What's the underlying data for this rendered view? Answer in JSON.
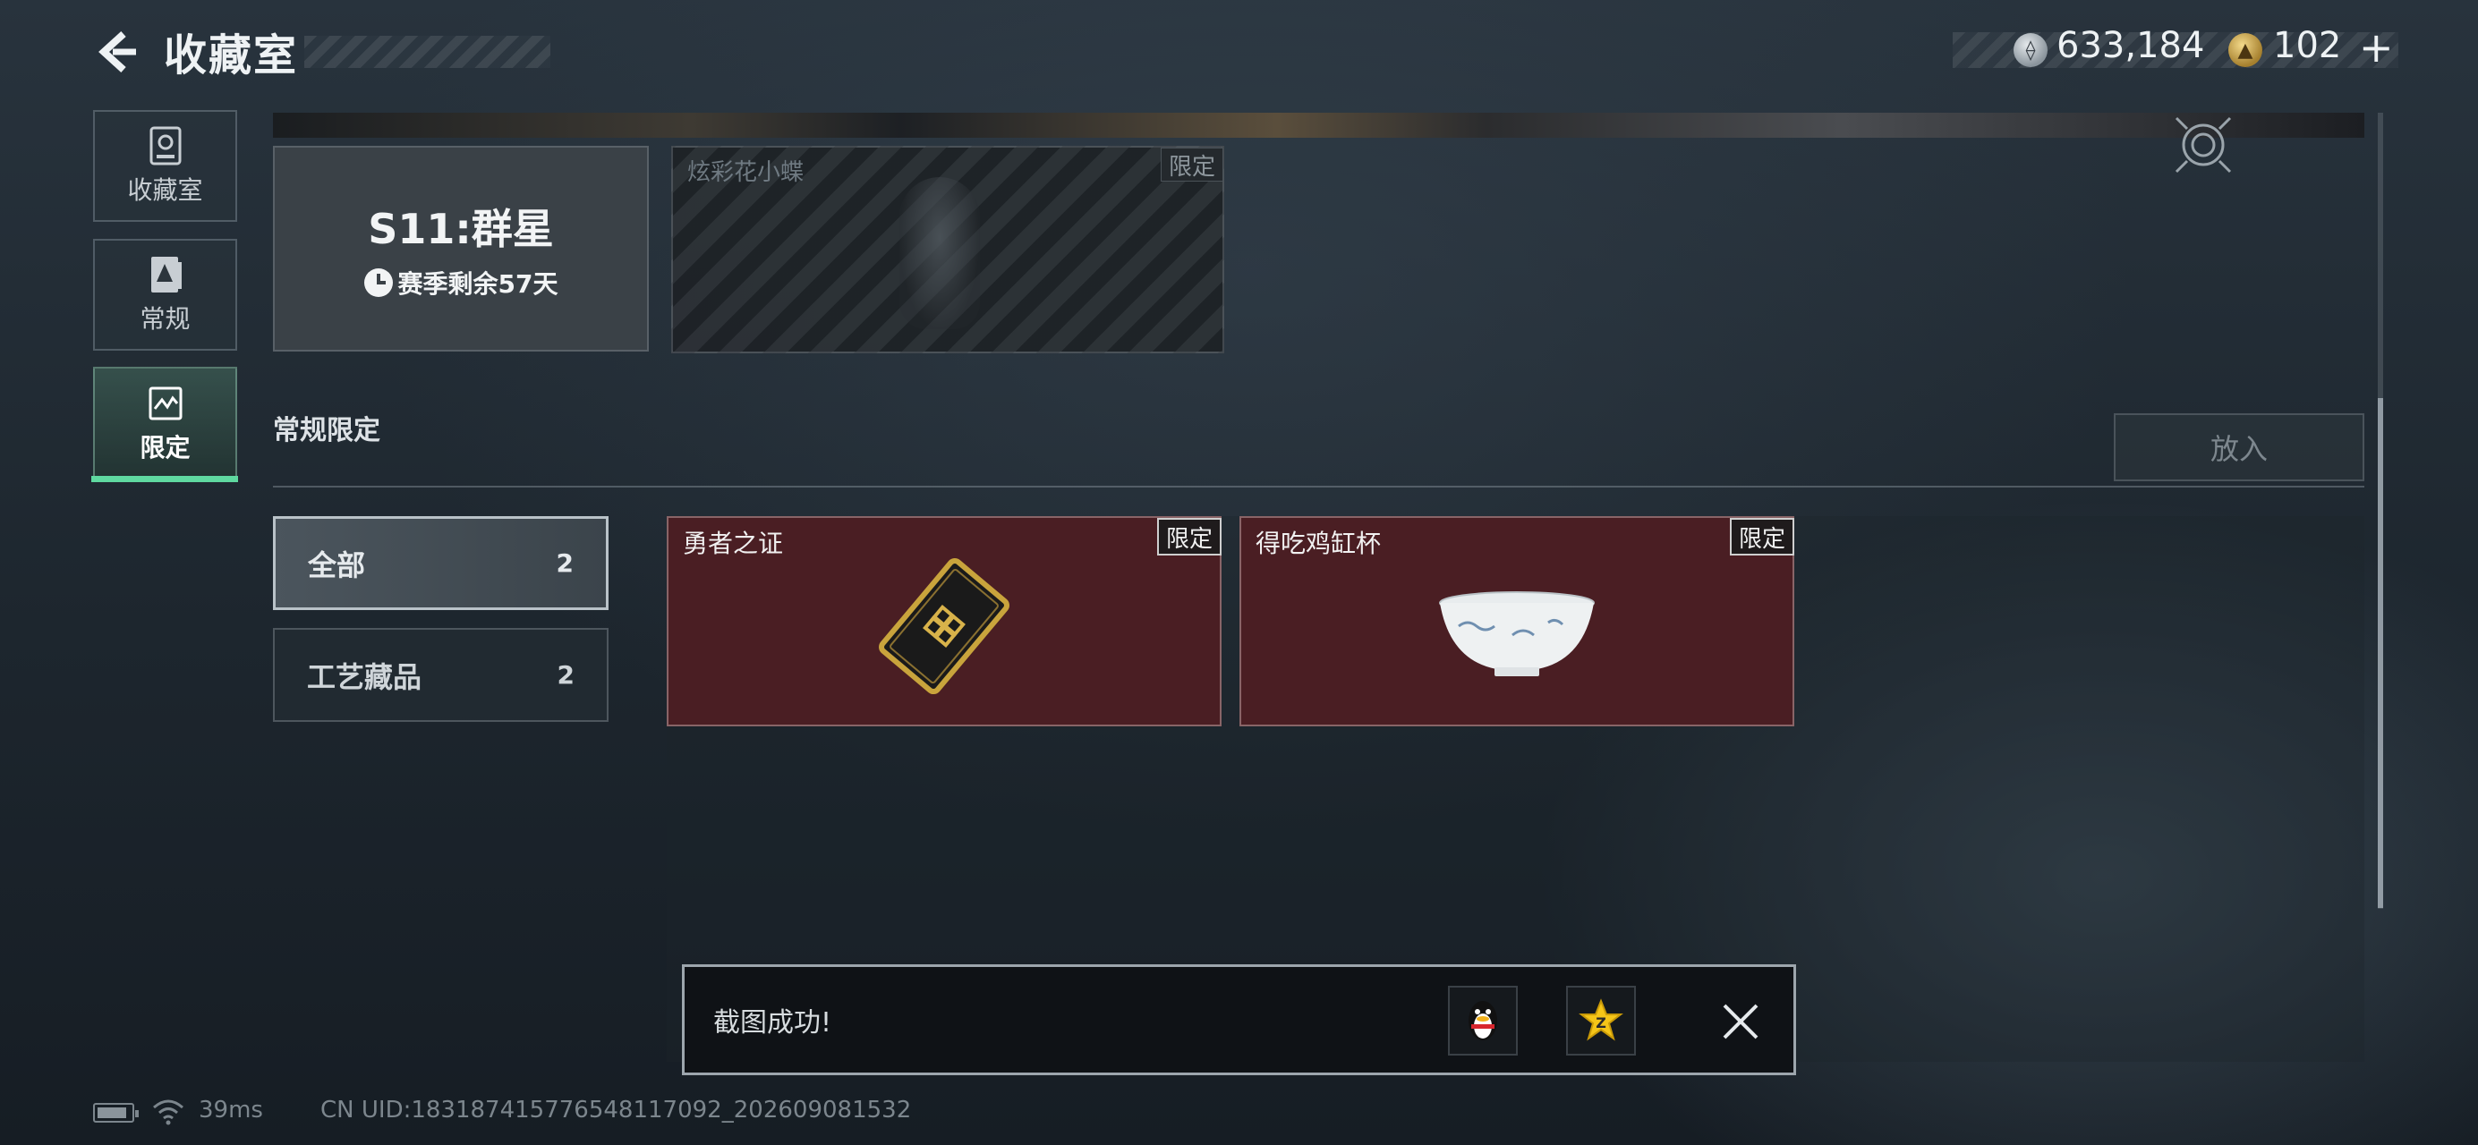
{
  "header": {
    "title": "收藏室",
    "currency_silver": "633,184",
    "currency_gold": "102",
    "add_symbol": "+"
  },
  "nav": {
    "items": [
      {
        "label": "收藏室",
        "icon": "vault-icon"
      },
      {
        "label": "常规",
        "icon": "card-icon"
      },
      {
        "label": "限定",
        "icon": "limited-icon",
        "active": true
      }
    ]
  },
  "season": {
    "title": "S11:群星",
    "remaining": "赛季剩余57天"
  },
  "locked_item": {
    "name": "炫彩花小蝶",
    "badge": "限定"
  },
  "section": {
    "title": "常规限定",
    "put_in_label": "放入"
  },
  "filters": [
    {
      "label": "全部",
      "count": "2",
      "selected": true
    },
    {
      "label": "工艺藏品",
      "count": "2",
      "selected": false
    }
  ],
  "items": [
    {
      "name": "勇者之证",
      "badge": "限定",
      "image": "brave-card-image"
    },
    {
      "name": "得吃鸡缸杯",
      "badge": "限定",
      "image": "porcelain-cup-image"
    }
  ],
  "toast": {
    "message": "截图成功!"
  },
  "status": {
    "ping": "39ms",
    "uid": "CN UID:1831874157765481170​92_202609081532"
  },
  "colors": {
    "accent_green": "#5fd9a0",
    "item_card_bg": "#4a1e23",
    "background": "#1d262e"
  }
}
